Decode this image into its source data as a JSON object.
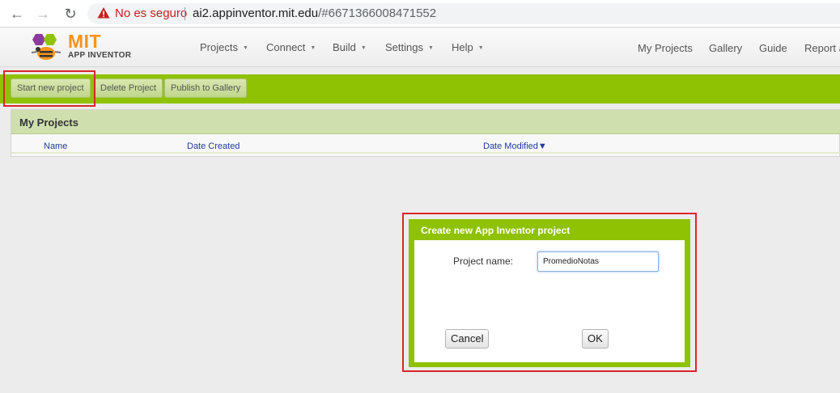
{
  "browser": {
    "security_label": "No es seguro",
    "url_host": "ai2.appinventor.mit.edu",
    "url_path": "/#6671366008471552"
  },
  "header": {
    "logo_title": "MIT",
    "logo_subtitle": "APP INVENTOR",
    "menus": [
      {
        "label": "Projects"
      },
      {
        "label": "Connect"
      },
      {
        "label": "Build"
      },
      {
        "label": "Settings"
      },
      {
        "label": "Help"
      }
    ],
    "links": [
      {
        "label": "My Projects"
      },
      {
        "label": "Gallery"
      },
      {
        "label": "Guide"
      },
      {
        "label": "Report a"
      }
    ]
  },
  "toolbar": {
    "start_new": "Start new project",
    "delete": "Delete Project",
    "publish": "Publish to Gallery"
  },
  "projects": {
    "title": "My Projects",
    "columns": {
      "name": "Name",
      "date_created": "Date Created",
      "date_modified": "Date Modified▼"
    }
  },
  "dialog": {
    "title": "Create new App Inventor project",
    "name_label": "Project name:",
    "name_value": "PromedioNotas",
    "cancel": "Cancel",
    "ok": "OK"
  },
  "colors": {
    "toolbar_green": "#8fc202",
    "highlight_red": "#d9262a",
    "logo_orange": "#f7931d"
  }
}
